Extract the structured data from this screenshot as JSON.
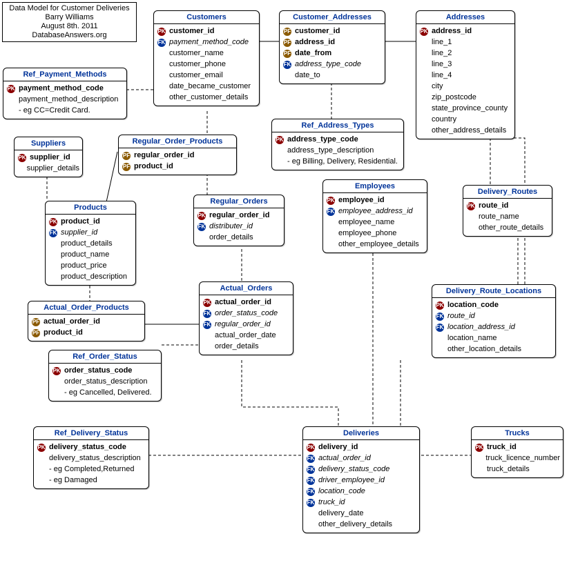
{
  "meta": {
    "line1": "Data Model for Customer Deliveries",
    "line2": "Barry Williams",
    "line3": "August 8th. 2011",
    "line4": "DatabaseAnswers.org"
  },
  "entities": {
    "customers": {
      "title": "Customers",
      "cols": [
        {
          "key": "pk",
          "keytext": "PK",
          "name": "customer_id",
          "bold": true
        },
        {
          "key": "fk",
          "keytext": "FK",
          "name": "payment_method_code",
          "italic": true
        },
        {
          "key": "",
          "name": "customer_name"
        },
        {
          "key": "",
          "name": "customer_phone"
        },
        {
          "key": "",
          "name": "customer_email"
        },
        {
          "key": "",
          "name": "date_became_customer"
        },
        {
          "key": "",
          "name": "other_customer_details"
        }
      ]
    },
    "customer_addresses": {
      "title": "Customer_Addresses",
      "cols": [
        {
          "key": "pf",
          "keytext": "PF",
          "name": "customer_id",
          "bold": true
        },
        {
          "key": "pf",
          "keytext": "PF",
          "name": "address_id",
          "bold": true
        },
        {
          "key": "pf",
          "keytext": "PF",
          "name": "date_from",
          "bold": true
        },
        {
          "key": "fk",
          "keytext": "FK",
          "name": "address_type_code",
          "italic": true
        },
        {
          "key": "",
          "name": "date_to"
        }
      ]
    },
    "addresses": {
      "title": "Addresses",
      "cols": [
        {
          "key": "pk",
          "keytext": "PK",
          "name": "address_id",
          "bold": true
        },
        {
          "key": "",
          "name": "line_1"
        },
        {
          "key": "",
          "name": "line_2"
        },
        {
          "key": "",
          "name": "line_3"
        },
        {
          "key": "",
          "name": "line_4"
        },
        {
          "key": "",
          "name": "city"
        },
        {
          "key": "",
          "name": "zip_postcode"
        },
        {
          "key": "",
          "name": "state_province_county"
        },
        {
          "key": "",
          "name": "country"
        },
        {
          "key": "",
          "name": "other_address_details"
        }
      ]
    },
    "ref_payment_methods": {
      "title": "Ref_Payment_Methods",
      "cols": [
        {
          "key": "pk",
          "keytext": "PK",
          "name": "payment_method_code",
          "bold": true
        },
        {
          "key": "",
          "name": "payment_method_description"
        },
        {
          "key": "",
          "name": "- eg CC=Credit Card."
        }
      ]
    },
    "ref_address_types": {
      "title": "Ref_Address_Types",
      "cols": [
        {
          "key": "pk",
          "keytext": "PK",
          "name": "address_type_code",
          "bold": true
        },
        {
          "key": "",
          "name": "address_type_description"
        },
        {
          "key": "",
          "name": "- eg Billing, Delivery, Residential."
        }
      ]
    },
    "suppliers": {
      "title": "Suppliers",
      "cols": [
        {
          "key": "pk",
          "keytext": "PK",
          "name": "supplier_id",
          "bold": true
        },
        {
          "key": "",
          "name": "supplier_details"
        }
      ]
    },
    "regular_order_products": {
      "title": "Regular_Order_Products",
      "cols": [
        {
          "key": "pf",
          "keytext": "PF",
          "name": "regular_order_id",
          "bold": true
        },
        {
          "key": "pf",
          "keytext": "PF",
          "name": "product_id",
          "bold": true
        }
      ]
    },
    "regular_orders": {
      "title": "Regular_Orders",
      "cols": [
        {
          "key": "pk",
          "keytext": "PK",
          "name": "regular_order_id",
          "bold": true
        },
        {
          "key": "fk",
          "keytext": "FK",
          "name": "distributer_id",
          "italic": true
        },
        {
          "key": "",
          "name": "order_details"
        }
      ]
    },
    "employees": {
      "title": "Employees",
      "cols": [
        {
          "key": "pk",
          "keytext": "PK",
          "name": "employee_id",
          "bold": true
        },
        {
          "key": "fk",
          "keytext": "FK",
          "name": "employee_address_id",
          "italic": true
        },
        {
          "key": "",
          "name": "employee_name"
        },
        {
          "key": "",
          "name": "employee_phone"
        },
        {
          "key": "",
          "name": "other_employee_details"
        }
      ]
    },
    "delivery_routes": {
      "title": "Delivery_Routes",
      "cols": [
        {
          "key": "pk",
          "keytext": "PK",
          "name": "route_id",
          "bold": true
        },
        {
          "key": "",
          "name": "route_name"
        },
        {
          "key": "",
          "name": "other_route_details"
        }
      ]
    },
    "products": {
      "title": "Products",
      "cols": [
        {
          "key": "pk",
          "keytext": "PK",
          "name": "product_id",
          "bold": true
        },
        {
          "key": "fk",
          "keytext": "FK",
          "name": "supplier_id",
          "italic": true
        },
        {
          "key": "",
          "name": "product_details"
        },
        {
          "key": "",
          "name": "product_name"
        },
        {
          "key": "",
          "name": "product_price"
        },
        {
          "key": "",
          "name": "product_description"
        }
      ]
    },
    "actual_order_products": {
      "title": "Actual_Order_Products",
      "cols": [
        {
          "key": "pf",
          "keytext": "PF",
          "name": "actual_order_id",
          "bold": true
        },
        {
          "key": "pf",
          "keytext": "PF",
          "name": "product_id",
          "bold": true
        }
      ]
    },
    "actual_orders": {
      "title": "Actual_Orders",
      "cols": [
        {
          "key": "pk",
          "keytext": "PK",
          "name": "actual_order_id",
          "bold": true
        },
        {
          "key": "fk",
          "keytext": "FK",
          "name": "order_status_code",
          "italic": true
        },
        {
          "key": "fk",
          "keytext": "FK",
          "name": "regular_order_id",
          "italic": true
        },
        {
          "key": "",
          "name": "actual_order_date"
        },
        {
          "key": "",
          "name": "order_details"
        }
      ]
    },
    "delivery_route_locations": {
      "title": "Delivery_Route_Locations",
      "cols": [
        {
          "key": "pk",
          "keytext": "PK",
          "name": "location_code",
          "bold": true
        },
        {
          "key": "fk",
          "keytext": "FK",
          "name": "route_id",
          "italic": true
        },
        {
          "key": "fk",
          "keytext": "FK",
          "name": "location_address_id",
          "italic": true
        },
        {
          "key": "",
          "name": "location_name"
        },
        {
          "key": "",
          "name": "other_location_details"
        }
      ]
    },
    "ref_order_status": {
      "title": "Ref_Order_Status",
      "cols": [
        {
          "key": "pk",
          "keytext": "PK",
          "name": "order_status_code",
          "bold": true
        },
        {
          "key": "",
          "name": "order_status_description"
        },
        {
          "key": "",
          "name": "- eg Cancelled, Delivered."
        }
      ]
    },
    "ref_delivery_status": {
      "title": "Ref_Delivery_Status",
      "cols": [
        {
          "key": "pk",
          "keytext": "PK",
          "name": "delivery_status_code",
          "bold": true
        },
        {
          "key": "",
          "name": "delivery_status_description"
        },
        {
          "key": "",
          "name": "- eg Completed,Returned"
        },
        {
          "key": "",
          "name": "- eg Damaged"
        }
      ]
    },
    "deliveries": {
      "title": "Deliveries",
      "cols": [
        {
          "key": "pk",
          "keytext": "PK",
          "name": "delivery_id",
          "bold": true
        },
        {
          "key": "fk",
          "keytext": "FK",
          "name": "actual_order_id",
          "italic": true
        },
        {
          "key": "fk",
          "keytext": "FK",
          "name": "delivery_status_code",
          "italic": true
        },
        {
          "key": "fk",
          "keytext": "FK",
          "name": "driver_employee_id",
          "italic": true
        },
        {
          "key": "fk",
          "keytext": "FK",
          "name": "location_code",
          "italic": true
        },
        {
          "key": "fk",
          "keytext": "FK",
          "name": "truck_id",
          "italic": true
        },
        {
          "key": "",
          "name": "delivery_date"
        },
        {
          "key": "",
          "name": "other_delivery_details"
        }
      ]
    },
    "trucks": {
      "title": "Trucks",
      "cols": [
        {
          "key": "pk",
          "keytext": "PK",
          "name": "truck_id",
          "bold": true
        },
        {
          "key": "",
          "name": "truck_licence_number"
        },
        {
          "key": "",
          "name": "truck_details"
        }
      ]
    }
  }
}
